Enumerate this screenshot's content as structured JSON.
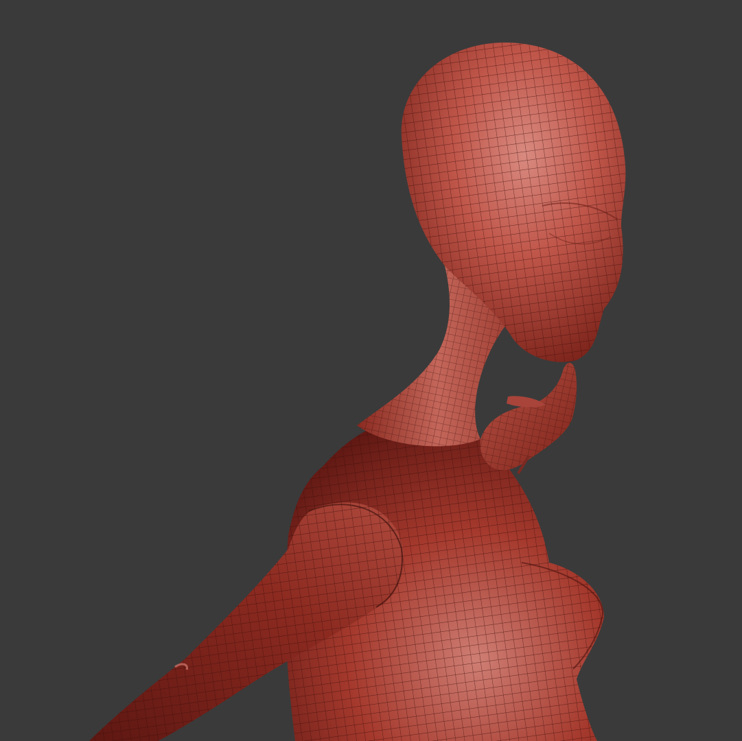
{
  "viewport": {
    "background_color": "#3a3a3a",
    "subject": "wireframe-shaded-human-figure",
    "mesh_base_color": "#b8483a",
    "mesh_highlight_color": "#d98a80",
    "mesh_shadow_color": "#5e1712",
    "wire_color": "#3a0f0b"
  }
}
